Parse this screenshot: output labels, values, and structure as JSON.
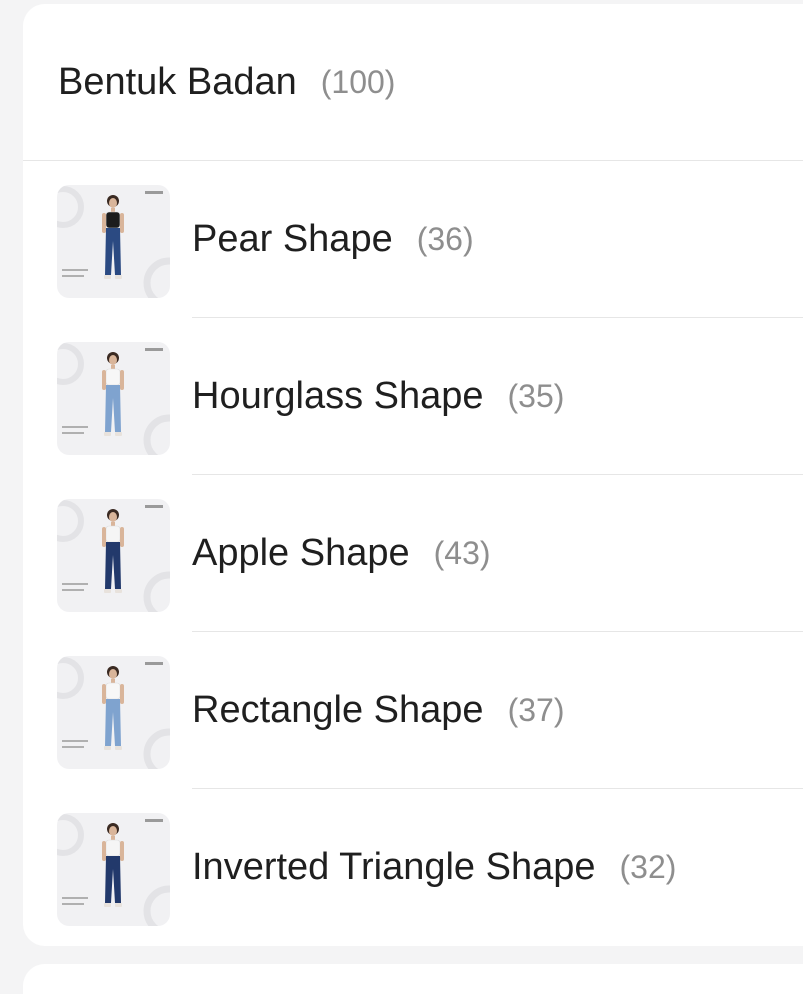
{
  "section": {
    "title": "Bentuk Badan",
    "count": "(100)"
  },
  "items": [
    {
      "label": "Pear Shape",
      "count": "(36)",
      "jeans_color": "#2b4a82",
      "top_color": "#1c1c1c"
    },
    {
      "label": "Hourglass Shape",
      "count": "(35)",
      "jeans_color": "#7fa3cf",
      "top_color": "#f7f7f7"
    },
    {
      "label": "Apple Shape",
      "count": "(43)",
      "jeans_color": "#22396b",
      "top_color": "#f5f5f5"
    },
    {
      "label": "Rectangle Shape",
      "count": "(37)",
      "jeans_color": "#7fa3cf",
      "top_color": "#f7f7f7"
    },
    {
      "label": "Inverted Triangle Shape",
      "count": "(32)",
      "jeans_color": "#22396b",
      "top_color": "#f5f5f5"
    }
  ]
}
